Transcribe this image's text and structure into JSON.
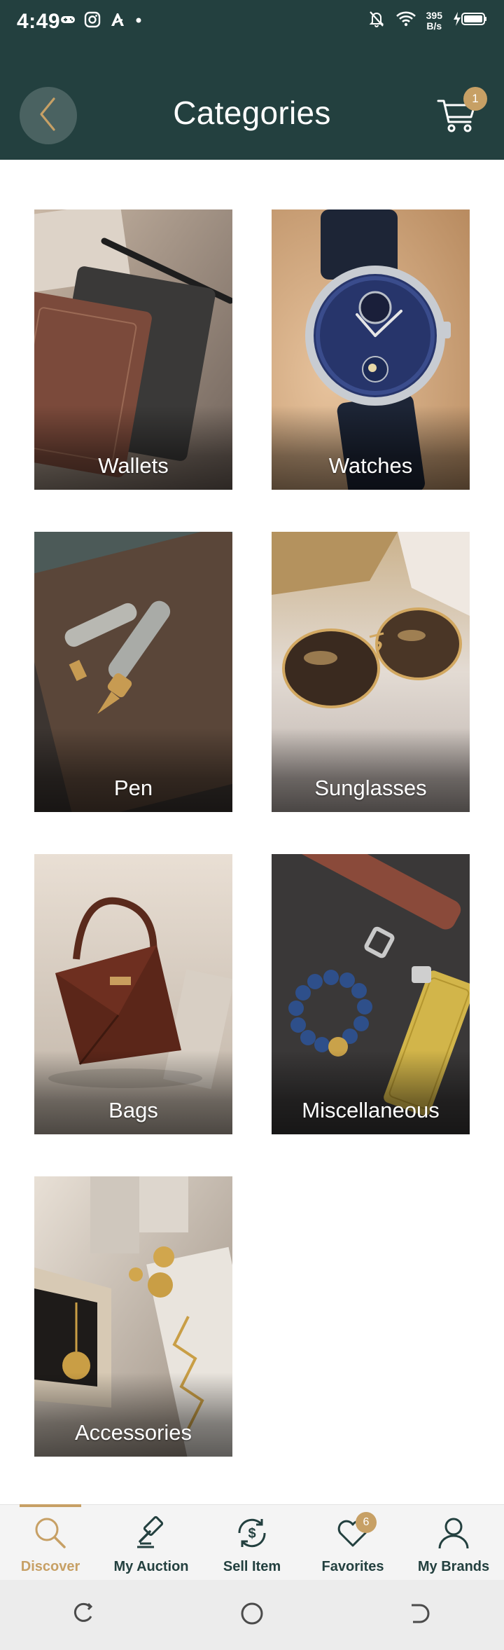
{
  "status_bar": {
    "time": "4:49",
    "net_speed_value": "395",
    "net_speed_unit": "B/s"
  },
  "header": {
    "title": "Categories",
    "cart_count": "1"
  },
  "categories": [
    {
      "label": "Wallets"
    },
    {
      "label": "Watches"
    },
    {
      "label": "Pen"
    },
    {
      "label": "Sunglasses"
    },
    {
      "label": "Bags"
    },
    {
      "label": "Miscellaneous"
    },
    {
      "label": "Accessories"
    }
  ],
  "bottom_nav": {
    "items": [
      {
        "label": "Discover",
        "icon": "search-icon",
        "active": true
      },
      {
        "label": "My Auction",
        "icon": "gavel-icon"
      },
      {
        "label": "Sell Item",
        "icon": "dollar-exchange-icon"
      },
      {
        "label": "Favorites",
        "icon": "heart-icon",
        "badge": "6"
      },
      {
        "label": "My Brands",
        "icon": "user-icon"
      }
    ]
  },
  "colors": {
    "header_bg": "#23403f",
    "accent_gold": "#c7a065",
    "nav_text": "#23403f"
  }
}
